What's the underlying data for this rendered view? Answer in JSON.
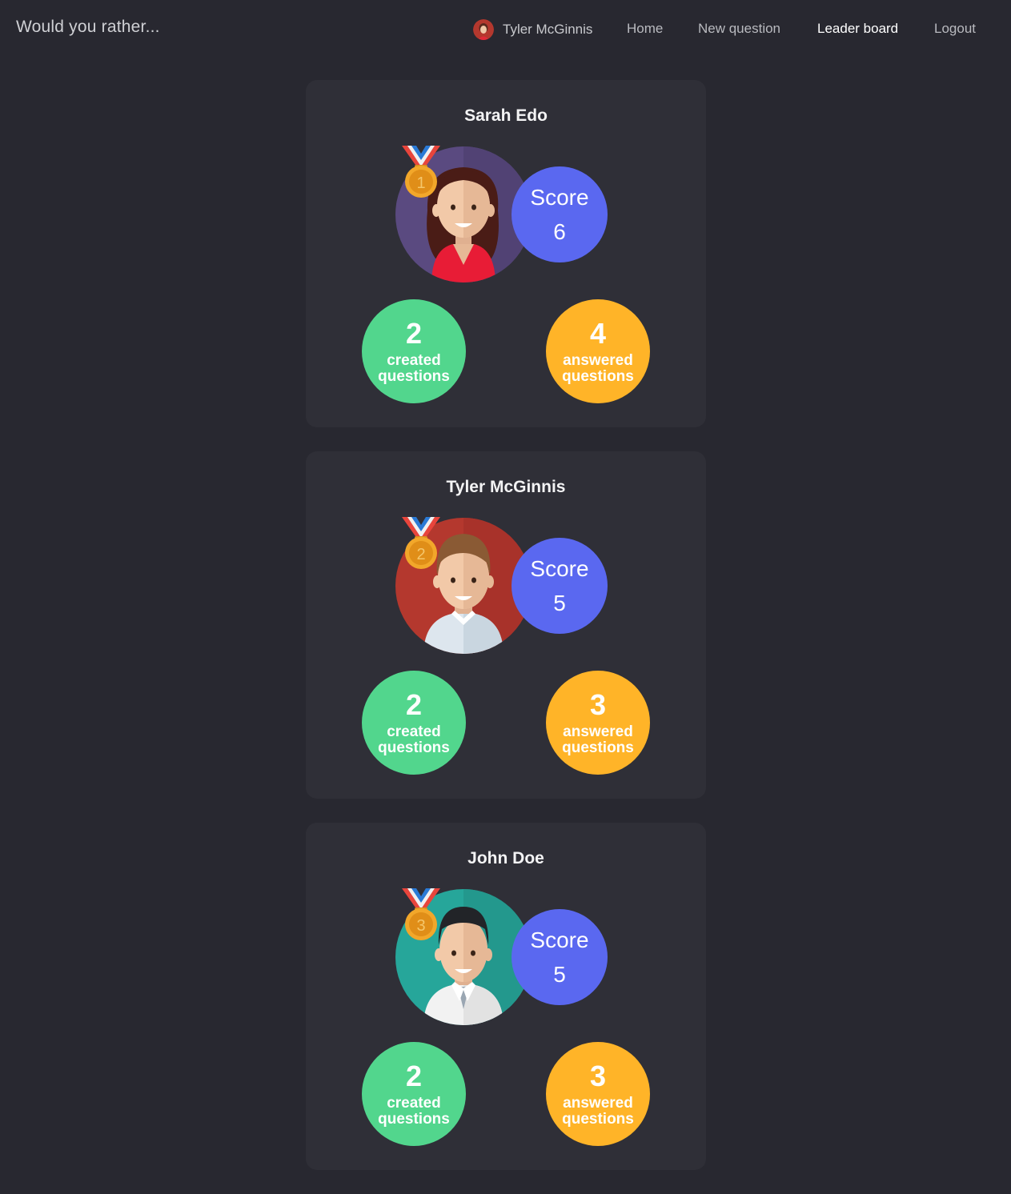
{
  "nav": {
    "brand": "Would you rather...",
    "user_name": "Tyler McGinnis",
    "links": {
      "home": "Home",
      "new_question": "New question",
      "leaderboard": "Leader board",
      "logout": "Logout"
    },
    "active": "leaderboard"
  },
  "leaderboard": [
    {
      "rank": "1",
      "name": "Sarah Edo",
      "avatar": "woman-avatar",
      "avatar_bg": "#5a4a80",
      "score_label": "Score",
      "score": "6",
      "created": "2",
      "created_label": "created questions",
      "answered": "4",
      "answered_label": "answered questions"
    },
    {
      "rank": "2",
      "name": "Tyler McGinnis",
      "avatar": "man-brown-hair-avatar",
      "avatar_bg": "#b4382e",
      "score_label": "Score",
      "score": "5",
      "created": "2",
      "created_label": "created questions",
      "answered": "3",
      "answered_label": "answered questions"
    },
    {
      "rank": "3",
      "name": "John Doe",
      "avatar": "man-dark-hair-avatar",
      "avatar_bg": "#26a69a",
      "score_label": "Score",
      "score": "5",
      "created": "2",
      "created_label": "created questions",
      "answered": "3",
      "answered_label": "answered questions"
    }
  ],
  "colors": {
    "background": "#282830",
    "card": "#2f2f37",
    "score": "#5a68f0",
    "created": "#52d68d",
    "answered": "#ffb428",
    "medal": "#f2a72a"
  }
}
